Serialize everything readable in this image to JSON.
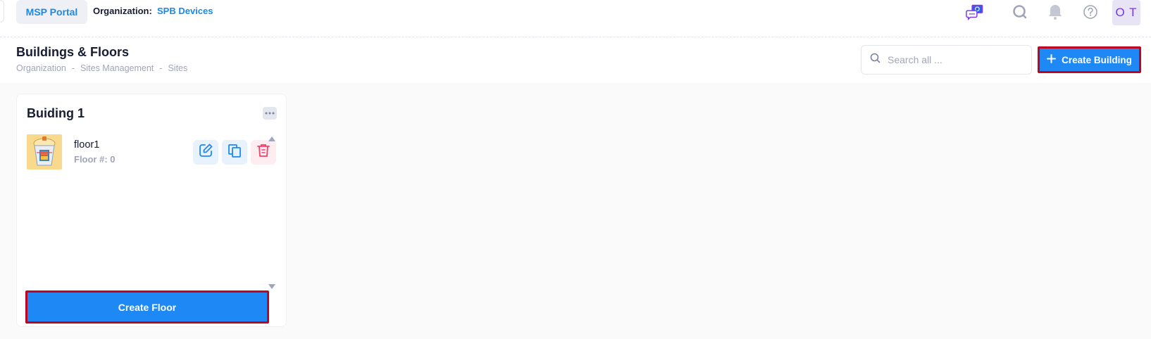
{
  "topbar": {
    "portal_label": "MSP Portal",
    "org_label": "Organization:",
    "org_value": "SPB Devices",
    "avatar_initials": "O T",
    "icons": [
      "chat-ai-icon",
      "search-icon",
      "bell-icon",
      "help-icon"
    ]
  },
  "header": {
    "title": "Buildings & Floors",
    "breadcrumb": [
      "Organization",
      "Sites Management",
      "Sites"
    ],
    "breadcrumb_sep": "-",
    "search_placeholder": "Search all ...",
    "create_building_label": "Create Building"
  },
  "building": {
    "title": "Buiding 1",
    "floors": [
      {
        "name": "floor1",
        "number_label": "Floor #: 0"
      }
    ],
    "create_floor_label": "Create Floor"
  },
  "colors": {
    "accent": "#1e88f5",
    "highlight_border": "#c0061e",
    "avatar_text": "#7239ea"
  }
}
